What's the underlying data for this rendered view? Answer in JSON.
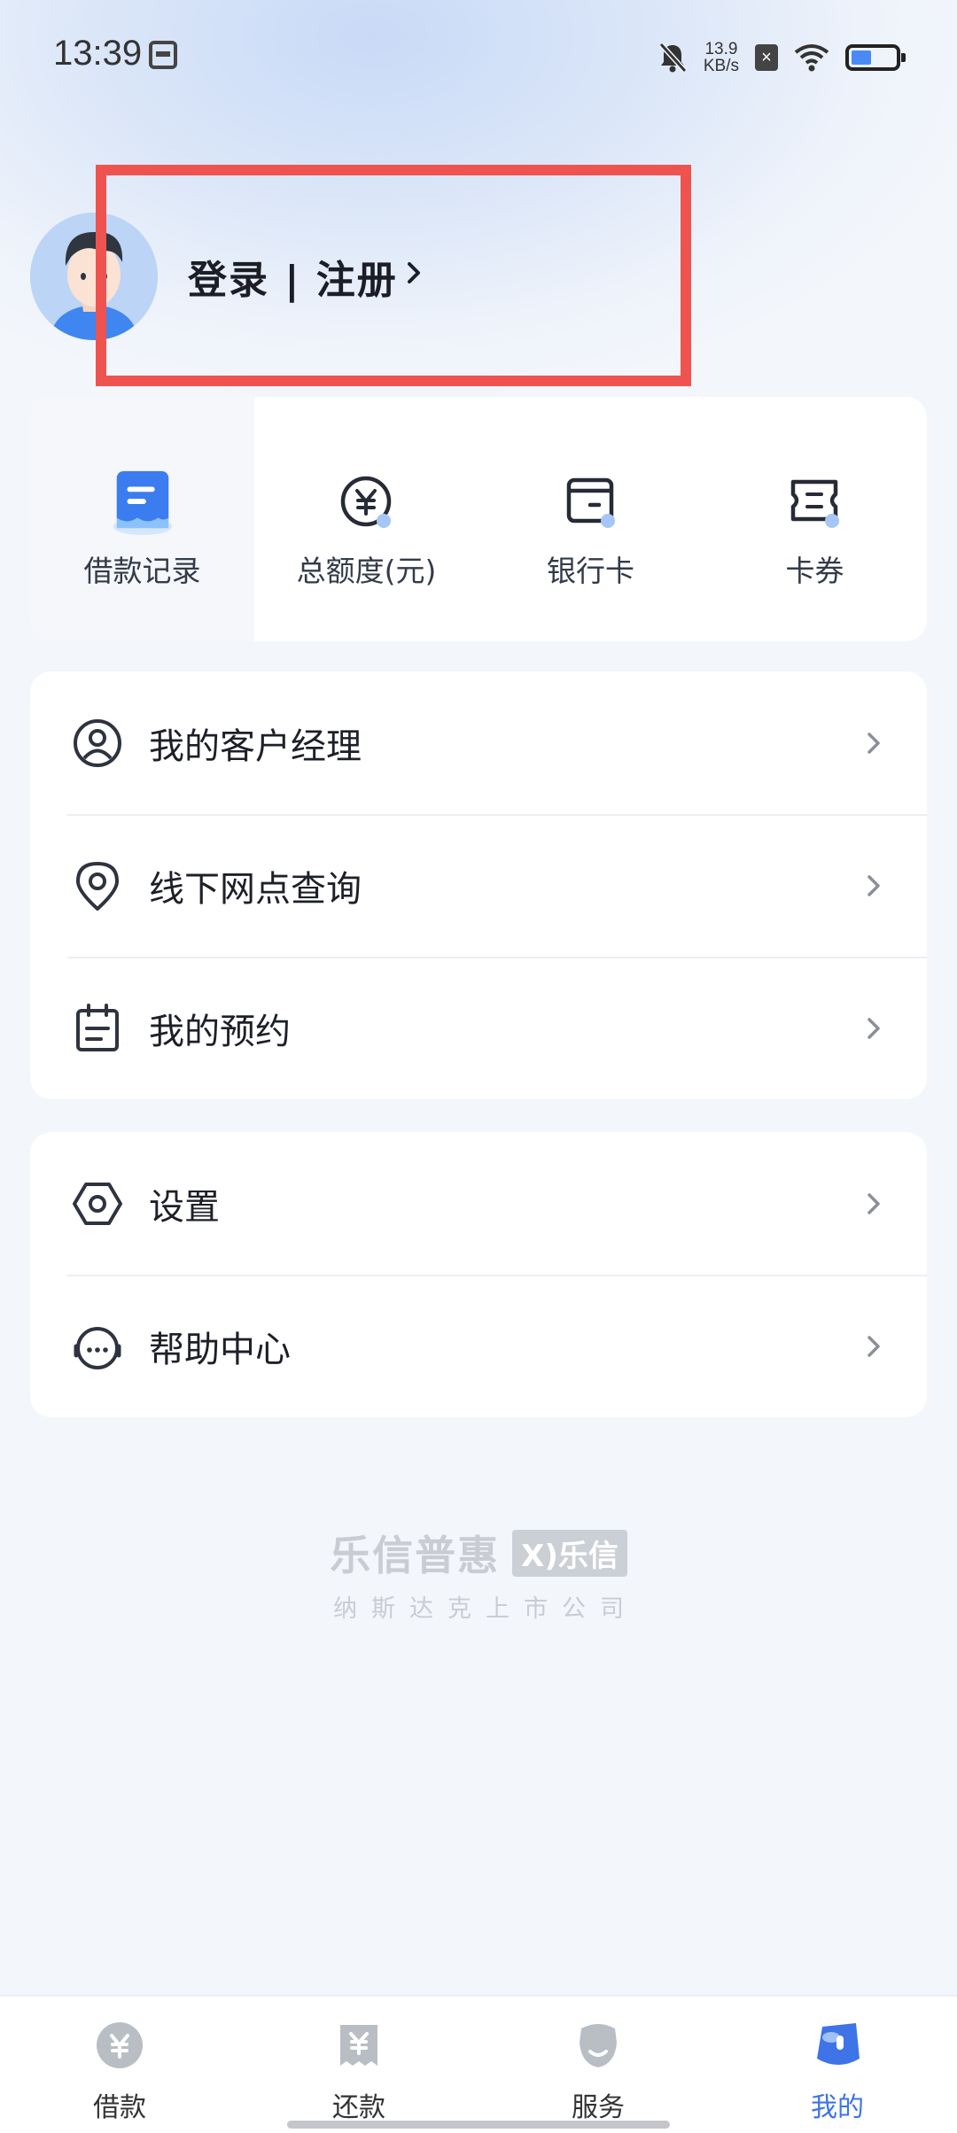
{
  "status_bar": {
    "time": "13:39",
    "net_speed_value": "13.9",
    "net_speed_unit": "KB/s",
    "icons": [
      "calendar-icon",
      "mute-bell-icon",
      "close-box-icon",
      "wifi-icon",
      "battery-icon"
    ]
  },
  "profile": {
    "login_label": "登录",
    "separator": "|",
    "register_label": "注册"
  },
  "quick_menu": [
    {
      "label": "借款记录",
      "icon": "loan-record-icon",
      "active": true
    },
    {
      "label": "总额度(元)",
      "icon": "yuan-circle-icon",
      "active": false
    },
    {
      "label": "银行卡",
      "icon": "bank-card-icon",
      "active": false
    },
    {
      "label": "卡券",
      "icon": "coupon-icon",
      "active": false
    }
  ],
  "menu_group_1": [
    {
      "label": "我的客户经理",
      "icon": "user-circle-icon"
    },
    {
      "label": "线下网点查询",
      "icon": "location-pin-icon"
    },
    {
      "label": "我的预约",
      "icon": "calendar-icon"
    }
  ],
  "menu_group_2": [
    {
      "label": "设置",
      "icon": "settings-hexagon-icon"
    },
    {
      "label": "帮助中心",
      "icon": "headset-icon"
    }
  ],
  "brand": {
    "name": "乐信普惠",
    "tag": "乐信",
    "subtitle": "纳斯达克上市公司"
  },
  "tab_bar": [
    {
      "label": "借款",
      "icon": "loan-tab-icon",
      "active": false
    },
    {
      "label": "还款",
      "icon": "repay-tab-icon",
      "active": false
    },
    {
      "label": "服务",
      "icon": "service-tab-icon",
      "active": false
    },
    {
      "label": "我的",
      "icon": "mine-tab-icon",
      "active": true
    }
  ],
  "colors": {
    "accent": "#3e74e8",
    "highlight_box": "#ef5350",
    "background": "#f3f6fb"
  }
}
